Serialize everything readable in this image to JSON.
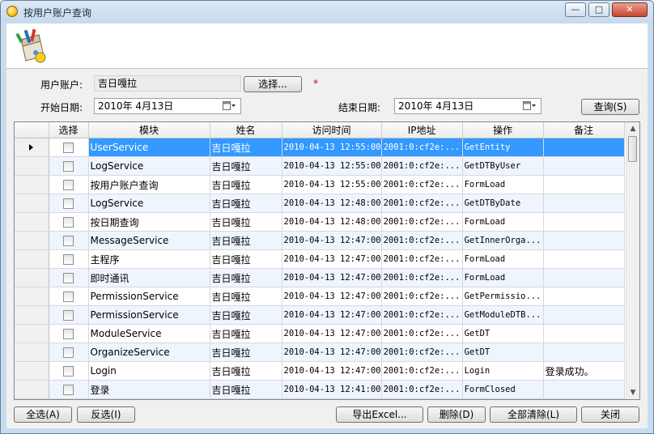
{
  "window": {
    "title": "按用户账户查询",
    "minimize": "—",
    "maximize": "□",
    "close": "✕"
  },
  "icons": [
    "app-icon",
    "toolbox-logo-icon",
    "calendar-icon",
    "row-pointer-icon"
  ],
  "form": {
    "user_label": "用户账户:",
    "user_value": "吉日嘎拉",
    "choose_btn": "选择...",
    "required_mark": "*",
    "start_label": "开始日期:",
    "start_value": "2010年 4月13日",
    "end_label": "结束日期:",
    "end_value": "2010年 4月13日",
    "query_btn": "查询(S)"
  },
  "grid": {
    "columns": [
      "选择",
      "模块",
      "姓名",
      "访问时间",
      "IP地址",
      "操作",
      "备注"
    ],
    "rows": [
      {
        "module": "UserService",
        "name": "吉日嘎拉",
        "time": "2010-04-13 12:55:00",
        "ip": "2001:0:cf2e:...",
        "op": "GetEntity",
        "note": ""
      },
      {
        "module": "LogService",
        "name": "吉日嘎拉",
        "time": "2010-04-13 12:55:00",
        "ip": "2001:0:cf2e:...",
        "op": "GetDTByUser",
        "note": ""
      },
      {
        "module": "按用户账户查询",
        "name": "吉日嘎拉",
        "time": "2010-04-13 12:55:00",
        "ip": "2001:0:cf2e:...",
        "op": "FormLoad",
        "note": ""
      },
      {
        "module": "LogService",
        "name": "吉日嘎拉",
        "time": "2010-04-13 12:48:00",
        "ip": "2001:0:cf2e:...",
        "op": "GetDTByDate",
        "note": ""
      },
      {
        "module": "按日期查询",
        "name": "吉日嘎拉",
        "time": "2010-04-13 12:48:00",
        "ip": "2001:0:cf2e:...",
        "op": "FormLoad",
        "note": ""
      },
      {
        "module": "MessageService",
        "name": "吉日嘎拉",
        "time": "2010-04-13 12:47:00",
        "ip": "2001:0:cf2e:...",
        "op": "GetInnerOrga...",
        "note": ""
      },
      {
        "module": "主程序",
        "name": "吉日嘎拉",
        "time": "2010-04-13 12:47:00",
        "ip": "2001:0:cf2e:...",
        "op": "FormLoad",
        "note": ""
      },
      {
        "module": "即时通讯",
        "name": "吉日嘎拉",
        "time": "2010-04-13 12:47:00",
        "ip": "2001:0:cf2e:...",
        "op": "FormLoad",
        "note": ""
      },
      {
        "module": "PermissionService",
        "name": "吉日嘎拉",
        "time": "2010-04-13 12:47:00",
        "ip": "2001:0:cf2e:...",
        "op": "GetPermissio...",
        "note": ""
      },
      {
        "module": "PermissionService",
        "name": "吉日嘎拉",
        "time": "2010-04-13 12:47:00",
        "ip": "2001:0:cf2e:...",
        "op": "GetModuleDTB...",
        "note": ""
      },
      {
        "module": "ModuleService",
        "name": "吉日嘎拉",
        "time": "2010-04-13 12:47:00",
        "ip": "2001:0:cf2e:...",
        "op": "GetDT",
        "note": ""
      },
      {
        "module": "OrganizeService",
        "name": "吉日嘎拉",
        "time": "2010-04-13 12:47:00",
        "ip": "2001:0:cf2e:...",
        "op": "GetDT",
        "note": ""
      },
      {
        "module": "Login",
        "name": "吉日嘎拉",
        "time": "2010-04-13 12:47:00",
        "ip": "2001:0:cf2e:...",
        "op": "Login",
        "note": "登录成功。"
      },
      {
        "module": "登录",
        "name": "吉日嘎拉",
        "time": "2010-04-13 12:41:00",
        "ip": "2001:0:cf2e:...",
        "op": "FormClosed",
        "note": ""
      }
    ],
    "selected_row": 0
  },
  "footer": {
    "select_all": "全选(A)",
    "invert": "反选(I)",
    "export": "导出Excel...",
    "delete": "删除(D)",
    "clear_all": "全部清除(L)",
    "close": "关闭"
  }
}
